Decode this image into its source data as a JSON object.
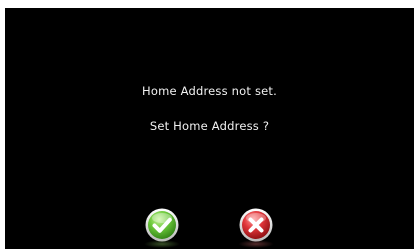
{
  "dialog": {
    "message_line1": "Home Address not set.",
    "message_line2": "Set Home Address ?"
  },
  "buttons": {
    "confirm": {
      "icon": "checkmark-icon",
      "color": "#5dbb2e"
    },
    "cancel": {
      "icon": "x-close-icon",
      "color": "#d9262b"
    }
  },
  "colors": {
    "background": "#000000",
    "text": "#f2f2f2"
  }
}
